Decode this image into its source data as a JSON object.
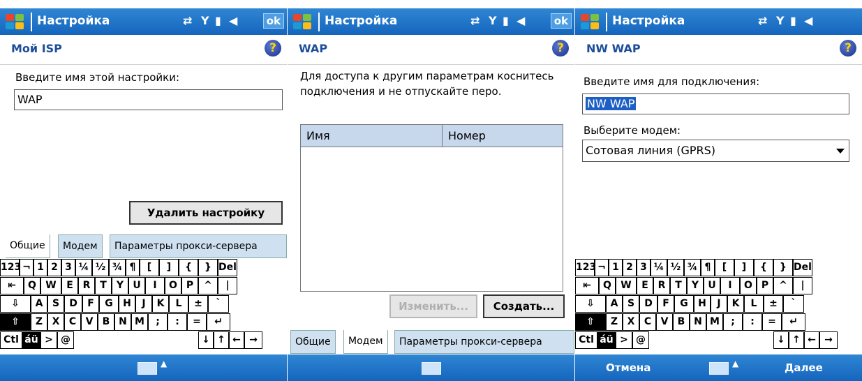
{
  "status": {
    "signal": "Y",
    "ok": "ok"
  },
  "screens": [
    {
      "title": "Настройка",
      "header": "Мой ISP",
      "prompt": "Введите имя этой настройки:",
      "name_value": "WAP",
      "delete_button": "Удалить настройку",
      "tabs": [
        "Общие",
        "Модем",
        "Параметры прокси-сервера"
      ]
    },
    {
      "title": "Настройка",
      "header": "WAP",
      "instructions": "Для доступа к другим параметрам коснитесь подключения и не отпускайте перо.",
      "columns": [
        "Имя",
        "Номер"
      ],
      "edit_button": "Изменить...",
      "create_button": "Создать...",
      "tabs": [
        "Общие",
        "Модем",
        "Параметры прокси-сервера"
      ]
    },
    {
      "title": "Настройка",
      "header": "NW WAP",
      "prompt": "Введите имя для подключения:",
      "name_value": "NW WAP",
      "modem_label": "Выберите модем:",
      "modem_value": "Сотовая линия (GPRS)",
      "cancel": "Отмена",
      "next": "Далее"
    }
  ],
  "keyboard": {
    "row1": [
      "123",
      "¬",
      "1",
      "2",
      "3",
      "¼",
      "½",
      "¾",
      "¶",
      "[",
      "]",
      "{",
      "}",
      "Del"
    ],
    "row2": [
      "⇤",
      "Q",
      "W",
      "E",
      "R",
      "T",
      "Y",
      "U",
      "I",
      "O",
      "P",
      "^",
      "|"
    ],
    "row3": [
      "⇩",
      "A",
      "S",
      "D",
      "F",
      "G",
      "H",
      "J",
      "K",
      "L",
      "±",
      "`"
    ],
    "row4": [
      "⇧",
      "Z",
      "X",
      "C",
      "V",
      "B",
      "N",
      "M",
      ";",
      ":",
      "=",
      "↵"
    ],
    "row5": [
      "Ctl",
      "áü",
      ">",
      "@",
      "↓",
      "↑",
      "←",
      "→"
    ]
  },
  "colors": {
    "bar": "#1e72c8",
    "tab": "#cfe0f0",
    "header_text": "#1d4e99"
  }
}
